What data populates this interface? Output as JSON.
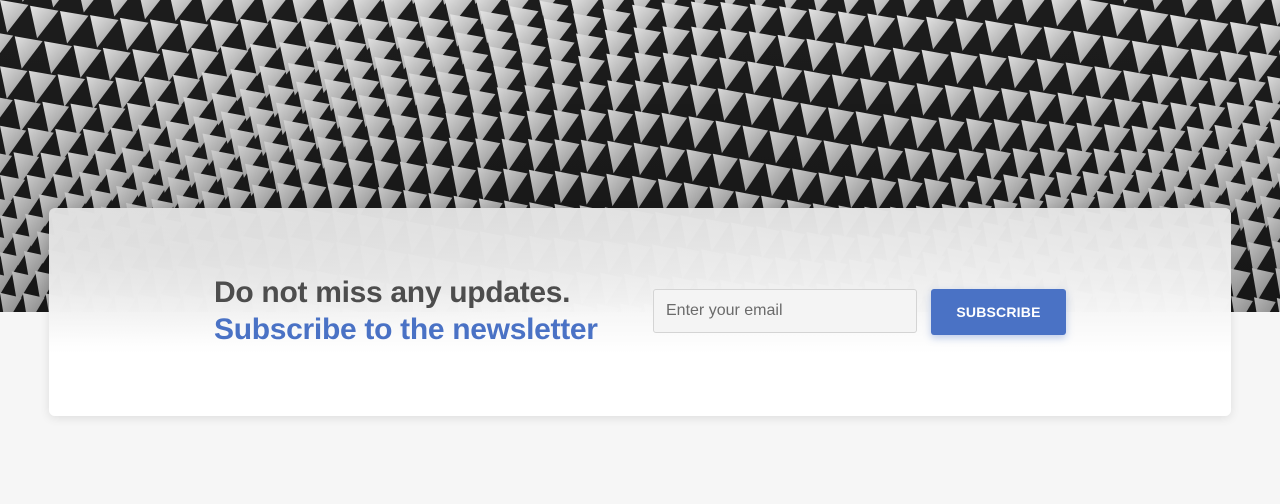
{
  "hero": {
    "image_name": "abstract-architecture-pattern"
  },
  "newsletter": {
    "headline_line1": "Do not miss any updates.",
    "headline_line2": "Subscribe to the newsletter",
    "email_placeholder": "Enter your email",
    "email_value": "",
    "subscribe_label": "SUBSCRIBE",
    "accent_color": "#4a72c5",
    "heading_color": "#4d4d4d"
  }
}
